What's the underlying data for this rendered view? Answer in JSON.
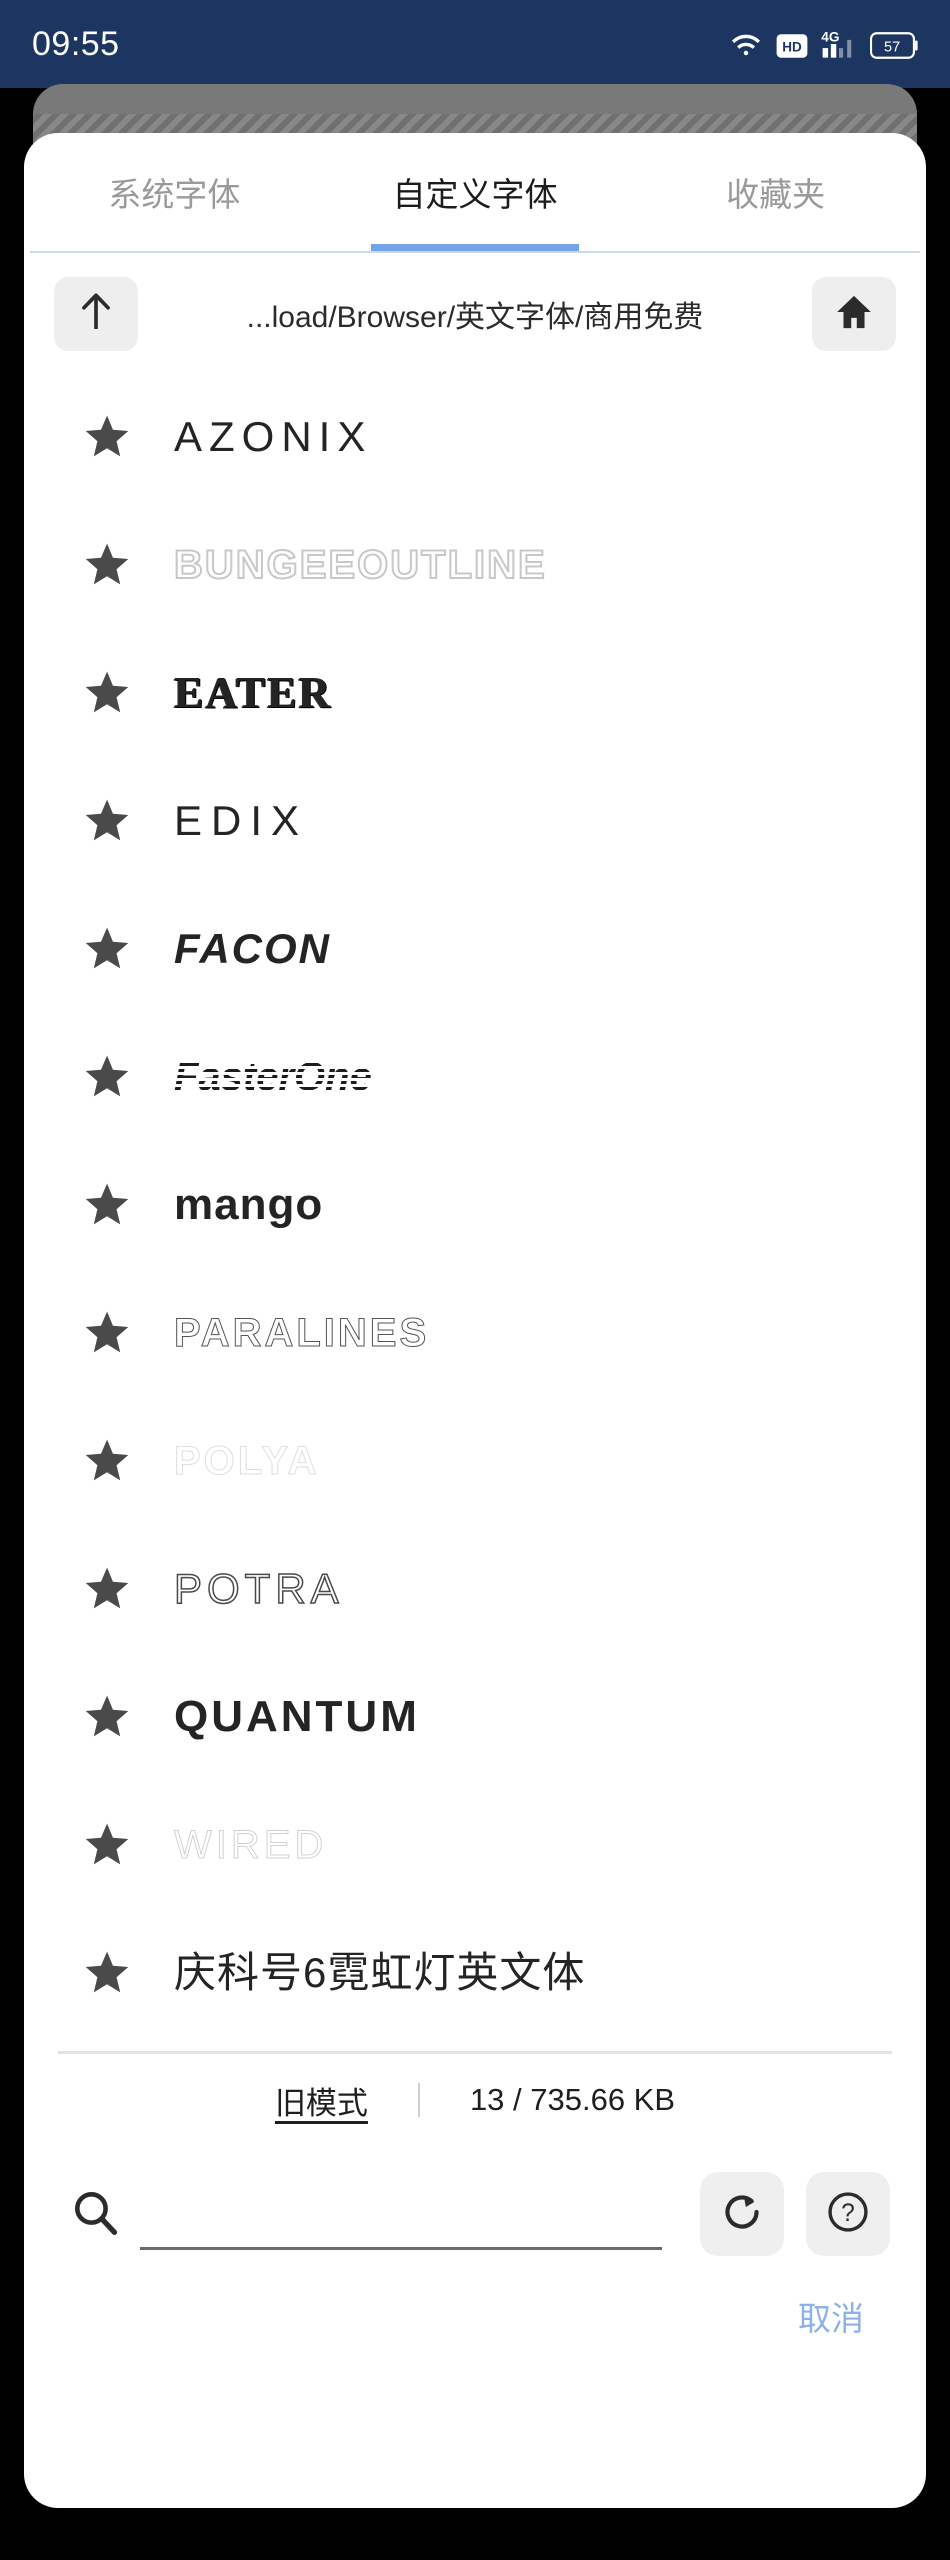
{
  "statusbar": {
    "time": "09:55",
    "icons": [
      "wifi-icon",
      "hd-icon",
      "4g-signal-icon",
      "battery-icon"
    ],
    "battery_level": "57",
    "bg_color": "#1d3661"
  },
  "dialog": {
    "tabs": [
      {
        "label": "系统字体",
        "active": false
      },
      {
        "label": "自定义字体",
        "active": true
      },
      {
        "label": "收藏夹",
        "active": false
      }
    ],
    "accent_color": "#74a4e8",
    "path_bar": {
      "up_icon": "arrow-up-icon",
      "path": "...load/Browser/英文字体/商用免费",
      "home_icon": "home-icon"
    },
    "font_list": [
      {
        "name": "AZONIX",
        "style": "s-azonix",
        "starred": true
      },
      {
        "name": "BUNGEEOUTLINE",
        "style": "s-outline",
        "starred": true
      },
      {
        "name": "EATER",
        "style": "s-eater",
        "starred": true
      },
      {
        "name": "EDIX",
        "style": "s-edix",
        "starred": true
      },
      {
        "name": "FACON",
        "style": "s-facon",
        "starred": true
      },
      {
        "name": "FasterOne",
        "style": "s-faster",
        "starred": true
      },
      {
        "name": "mango",
        "style": "s-mango",
        "starred": true
      },
      {
        "name": "PARALINES",
        "style": "s-paralines",
        "starred": true
      },
      {
        "name": "POLYA",
        "style": "s-polya",
        "starred": true
      },
      {
        "name": "POTRA",
        "style": "s-potra",
        "starred": true
      },
      {
        "name": "QUANTUM",
        "style": "s-quantum",
        "starred": true
      },
      {
        "name": "WIRED",
        "style": "s-wired",
        "starred": true
      },
      {
        "name": "庆科号6霓虹灯英文体",
        "style": "s-cjk",
        "starred": true
      }
    ],
    "status": {
      "old_mode_label": "旧模式",
      "divider": "|",
      "size_info": "13 / 735.66 KB"
    },
    "search": {
      "icon": "search-icon",
      "value": "",
      "placeholder": "",
      "refresh_icon": "refresh-icon",
      "help_icon": "help-circle-icon"
    },
    "cancel_label": "取消"
  }
}
